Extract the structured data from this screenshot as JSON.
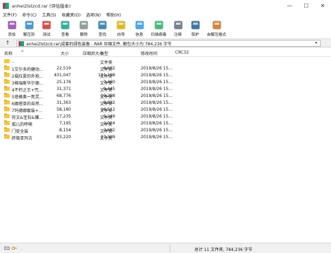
{
  "window": {
    "title": "anhei2lstzcd.rar (评估版本)"
  },
  "window_buttons": {
    "minimize": "—",
    "maximize": "☐",
    "close": "✕"
  },
  "menu": [
    "文件(F)",
    "命令(C)",
    "工具(S)",
    "收藏夹(O)",
    "选项(N)",
    "帮助(H)"
  ],
  "toolbar": [
    {
      "label": "添加",
      "icon": "add-archive-icon",
      "color": "#8e44ad"
    },
    {
      "label": "解压到",
      "icon": "extract-to-icon",
      "color": "#2e86c1"
    },
    {
      "label": "测试",
      "icon": "test-icon",
      "color": "#c0392b"
    },
    {
      "label": "查看",
      "icon": "view-icon",
      "color": "#16a085"
    },
    {
      "label": "删除",
      "icon": "delete-icon",
      "color": "#7f8c8d"
    },
    {
      "label": "查找",
      "icon": "find-icon",
      "color": "#2874a6"
    },
    {
      "label": "向导",
      "icon": "wizard-icon",
      "color": "#d4ac0d"
    },
    {
      "label": "信息",
      "icon": "info-icon",
      "color": "#3498db"
    },
    {
      "label": "扫描病毒",
      "icon": "scan-virus-icon",
      "color": "#27ae60"
    },
    {
      "label": "注释",
      "icon": "comment-icon",
      "color": "#5d6d7e"
    },
    {
      "label": "保护",
      "icon": "protect-icon",
      "color": "#1f618d"
    },
    {
      "label": "自解压格式",
      "icon": "sfx-icon",
      "color": "#ca6f1e"
    }
  ],
  "path": {
    "text": "anhei2lstzcd.rar\\成套的绿色装备 - RAR 压缩文件, 解包大小为 784,236 字节"
  },
  "columns": {
    "name": "名称",
    "size": "大小",
    "compressed": "压缩后大小",
    "type": "类型",
    "modified": "修改时间",
    "crc": "CRC32"
  },
  "updir": {
    "name": "..",
    "type": "文件夹"
  },
  "files": [
    {
      "name": "1艾尔多的健动...",
      "size": "22,519",
      "compressed": "6,602",
      "type": "文件夹",
      "modified": "2019/8/26 15..."
    },
    {
      "name": "2福拉夏的外袍...",
      "size": "431,047",
      "compressed": "121,198",
      "type": "文件夹",
      "modified": "2019/8/26 15..."
    },
    {
      "name": "3格瑞斯华尔德...",
      "size": "25,176",
      "compressed": "7,460",
      "type": "文件夹",
      "modified": "2019/8/26 15..."
    },
    {
      "name": "4不朽之王+咒...",
      "size": "31,371",
      "compressed": "9,445",
      "type": "文件夹",
      "modified": "2019/8/26 15..."
    },
    {
      "name": "5塔格奥一死灵...",
      "size": "68,776",
      "compressed": "19,288",
      "type": "文件夹",
      "modified": "2019/8/26 15..."
    },
    {
      "name": "6娜塔亚的自然...",
      "size": "31,363",
      "compressed": "8,832",
      "type": "文件夹",
      "modified": "2019/8/26 15..."
    },
    {
      "name": "7玛德娜套装+...",
      "size": "58,180",
      "compressed": "16,512",
      "type": "文件夹",
      "modified": "2019/8/26 15..."
    },
    {
      "name": "符文&宝石&镶...",
      "size": "17,235",
      "compressed": "5,249",
      "type": "文件夹",
      "modified": "2019/8/26 15..."
    },
    {
      "name": "孤儿的呼唤",
      "size": "7,195",
      "compressed": "2,024",
      "type": "文件夹",
      "modified": "2019/8/26 15..."
    },
    {
      "name": "门徒全装",
      "size": "8,154",
      "compressed": "2,682",
      "type": "文件夹",
      "modified": "2019/8/26 15..."
    },
    {
      "name": "终极亚玛古",
      "size": "83,220",
      "compressed": "27,309",
      "type": "文件夹",
      "modified": "2019/8/26 15..."
    }
  ],
  "status": {
    "summary": "总计 11 文件夹, 784,236 字节"
  }
}
